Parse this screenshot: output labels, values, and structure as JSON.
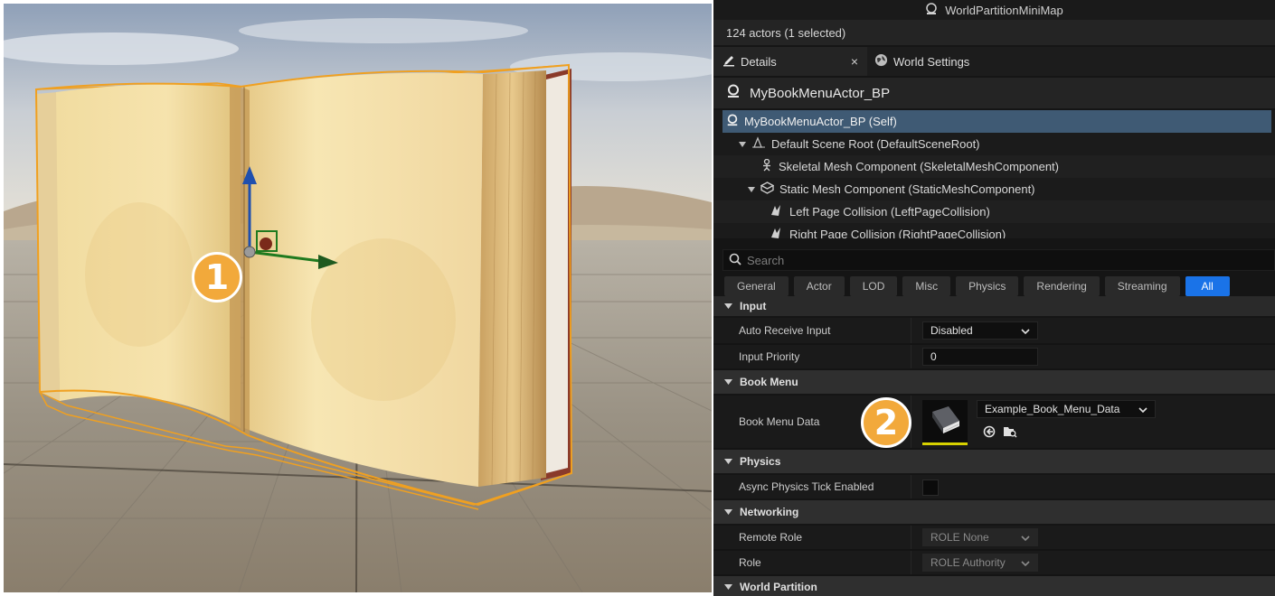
{
  "viewport": {
    "label": "Level viewport",
    "badge_1": "1"
  },
  "panel": {
    "minimap_title": "WorldPartitionMiniMap",
    "actor_count": "124 actors (1 selected)",
    "tabs": [
      {
        "label": "Details",
        "icon": "pencil-icon",
        "active": true
      },
      {
        "label": "World Settings",
        "icon": "globe-icon",
        "active": false
      }
    ],
    "close_glyph": "×",
    "actor_name": "MyBookMenuActor_BP",
    "components": [
      {
        "label": "MyBookMenuActor_BP (Self)",
        "icon": "actor-icon",
        "selected": true
      },
      {
        "label": "Default Scene Root (DefaultSceneRoot)",
        "icon": "scene-root-icon"
      },
      {
        "label": "Skeletal Mesh Component (SkeletalMeshComponent)",
        "icon": "skeleton-icon"
      },
      {
        "label": "Static Mesh Component (StaticMeshComponent)",
        "icon": "static-mesh-icon"
      },
      {
        "label": "Left Page Collision (LeftPageCollision)",
        "icon": "collision-icon"
      },
      {
        "label": "Right Page Collision (RightPageCollision)",
        "icon": "collision-icon"
      }
    ],
    "search_placeholder": "Search",
    "filters": [
      "General",
      "Actor",
      "LOD",
      "Misc",
      "Physics",
      "Rendering",
      "Streaming",
      "All"
    ],
    "active_filter": "All",
    "categories": {
      "input": "Input",
      "book_menu": "Book Menu",
      "physics": "Physics",
      "networking": "Networking",
      "world_partition": "World Partition"
    },
    "properties": {
      "auto_receive_input": {
        "label": "Auto Receive Input",
        "value": "Disabled"
      },
      "input_priority": {
        "label": "Input Priority",
        "value": "0"
      },
      "book_menu_data": {
        "label": "Book Menu Data",
        "value": "Example_Book_Menu_Data"
      },
      "async_physics_tick": {
        "label": "Async Physics Tick Enabled",
        "checked": false
      },
      "remote_role": {
        "label": "Remote Role",
        "value": "ROLE None"
      },
      "role": {
        "label": "Role",
        "value": "ROLE Authority"
      }
    },
    "badge_2": "2"
  },
  "colors": {
    "accent_blue": "#1a73e8",
    "selection": "#3f5a74",
    "badge_orange": "#f2a93b",
    "selection_outline": "#f0a020"
  }
}
